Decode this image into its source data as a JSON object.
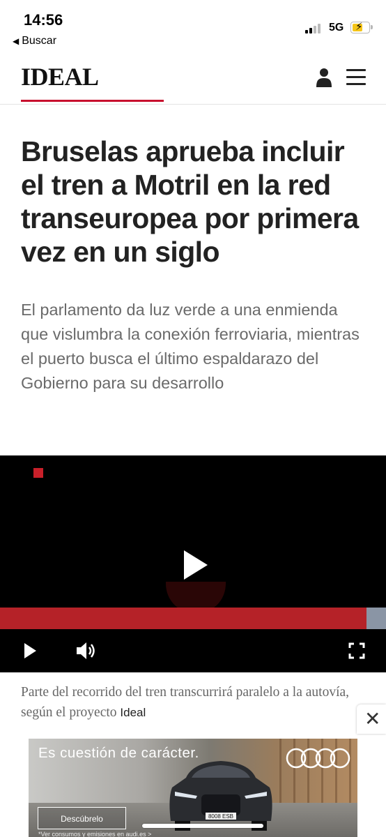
{
  "status_bar": {
    "time": "14:56",
    "back_label": "Buscar",
    "network": "5G"
  },
  "header": {
    "logo": "IDEAL",
    "accent_color": "#c8102e",
    "icons": [
      "user-icon",
      "menu-icon"
    ]
  },
  "article": {
    "headline": "Bruselas aprueba incluir el tren a Motril en la red transeuropea por primera vez en un siglo",
    "subheadline": "El parlamento da luz verde a una enmienda que vislumbra la conexión ferroviaria, mientras el puerto busca el último espaldarazo del Gobierno para su desarrollo"
  },
  "video": {
    "progress_fraction": 0.95,
    "controls": [
      "play-icon",
      "volume-icon",
      "fullscreen-icon"
    ]
  },
  "caption": {
    "text": "Parte del recorrido del tren transcurrirá paralelo a la autovía, según el proyecto",
    "credit": "Ideal"
  },
  "ad": {
    "headline": "Es cuestión de carácter.",
    "button_label": "Descúbrelo",
    "legal": "*Ver consumos y emisiones en audi.es >",
    "plate": "8008 ESB"
  }
}
